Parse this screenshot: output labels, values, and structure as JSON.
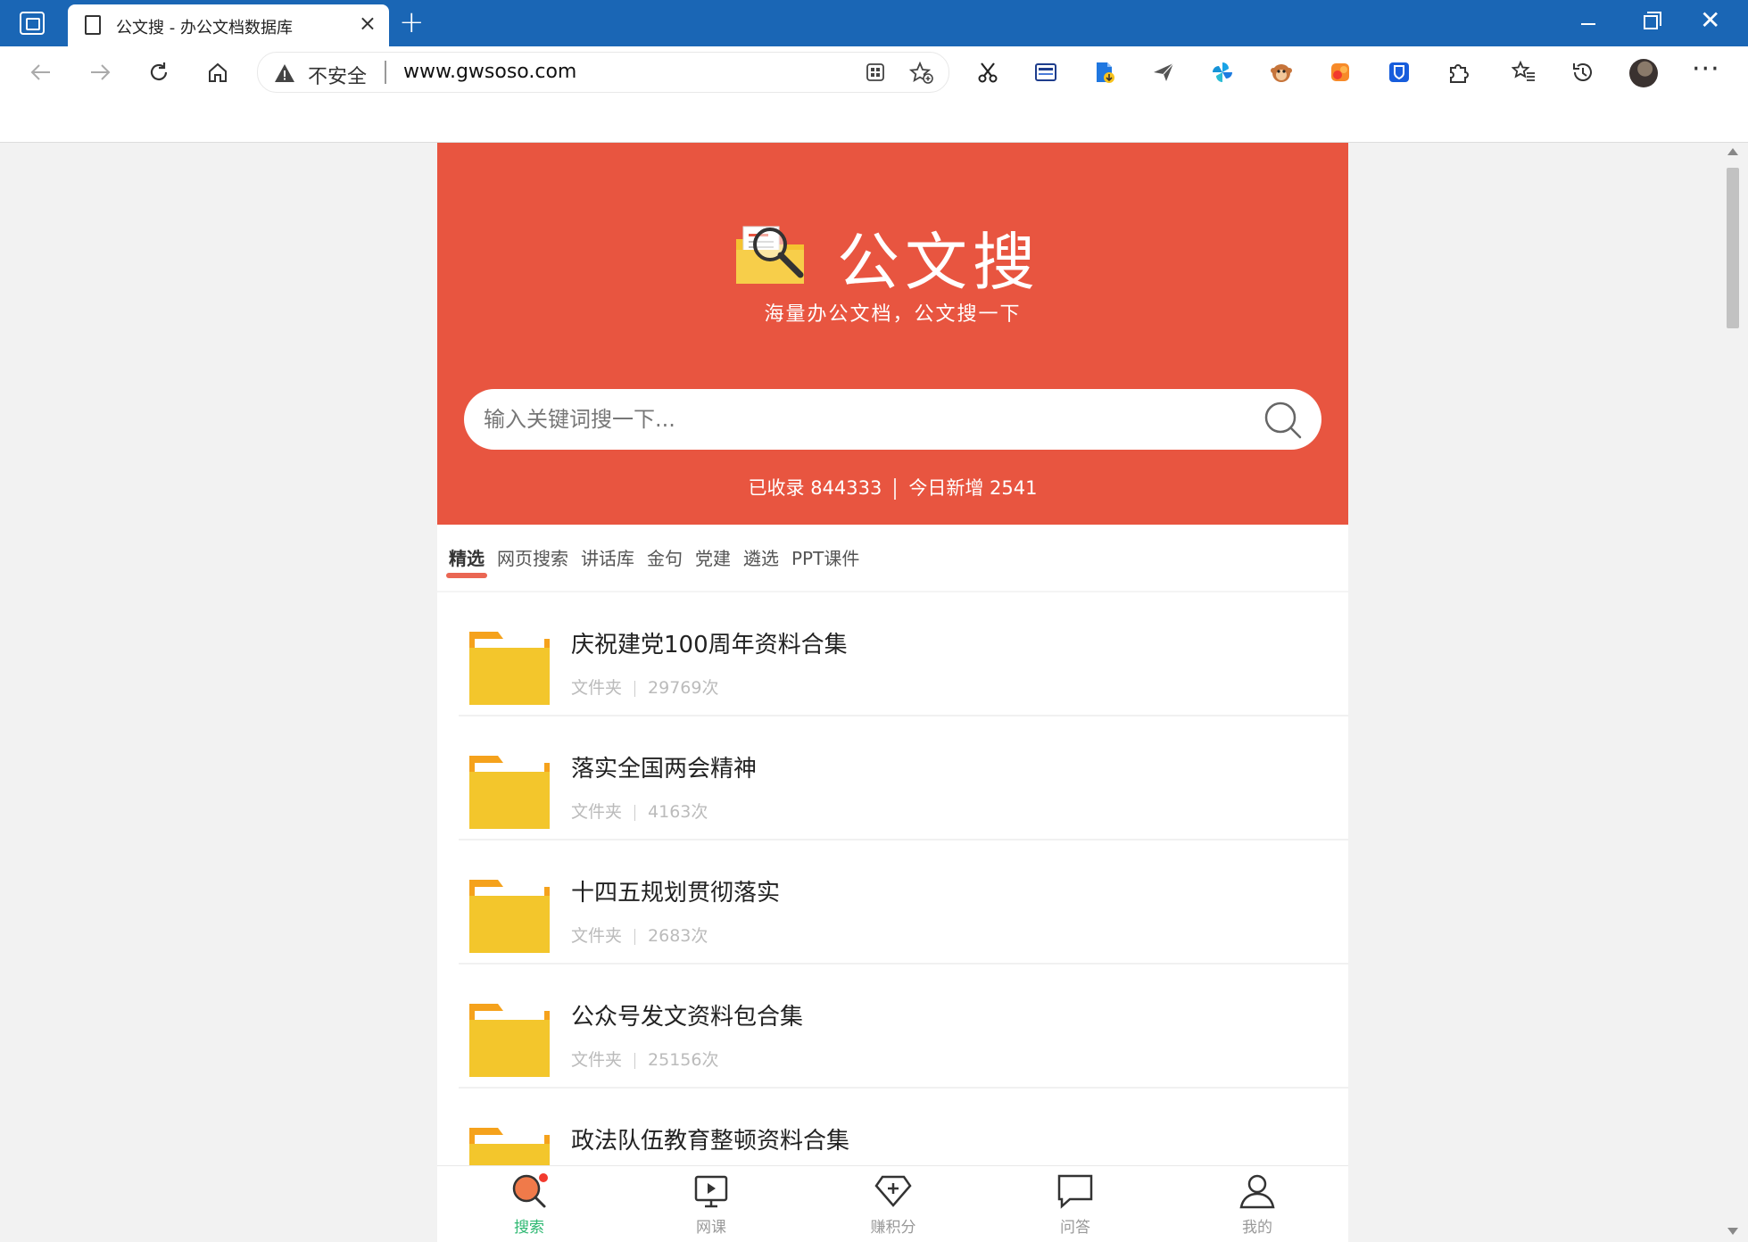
{
  "browser": {
    "tab_title": "公文搜 - 办公文档数据库",
    "tab_close": "×",
    "new_tab": "+",
    "window_close": "✕",
    "insecure_label": "不安全",
    "url": "www.gwsoso.com",
    "menu": "···"
  },
  "toolbar_icons": [
    "scissors-icon",
    "sidebar-icon",
    "document-download-icon",
    "send-icon",
    "pinwheel-icon",
    "monkey-extension-icon",
    "orange-extension-icon",
    "shield-extension-icon",
    "puzzle-icon",
    "favorites-icon",
    "history-icon"
  ],
  "hero": {
    "title": "公文搜",
    "subtitle": "海量办公文档，公文搜一下",
    "search_placeholder": "输入关键词搜一下...",
    "stats_total": "已收录 844333",
    "stats_today": "今日新增 2541",
    "bg_color": "#e85540"
  },
  "categories": [
    "精选",
    "网页搜索",
    "讲话库",
    "金句",
    "党建",
    "遴选",
    "PPT课件"
  ],
  "active_category": "精选",
  "items": [
    {
      "title": "庆祝建党100周年资料合集",
      "type": "文件夹",
      "views": "29769次"
    },
    {
      "title": "落实全国两会精神",
      "type": "文件夹",
      "views": "4163次"
    },
    {
      "title": "十四五规划贯彻落实",
      "type": "文件夹",
      "views": "2683次"
    },
    {
      "title": "公众号发文资料包合集",
      "type": "文件夹",
      "views": "25156次"
    },
    {
      "title": "政法队伍教育整顿资料合集",
      "type": "",
      "views": ""
    }
  ],
  "bottom_nav": [
    {
      "label": "搜索",
      "icon": "search-nav-icon",
      "active": true
    },
    {
      "label": "网课",
      "icon": "video-lesson-icon",
      "active": false
    },
    {
      "label": "赚积分",
      "icon": "diamond-plus-icon",
      "active": false
    },
    {
      "label": "问答",
      "icon": "chat-bubble-icon",
      "active": false
    },
    {
      "label": "我的",
      "icon": "user-icon",
      "active": false
    }
  ]
}
